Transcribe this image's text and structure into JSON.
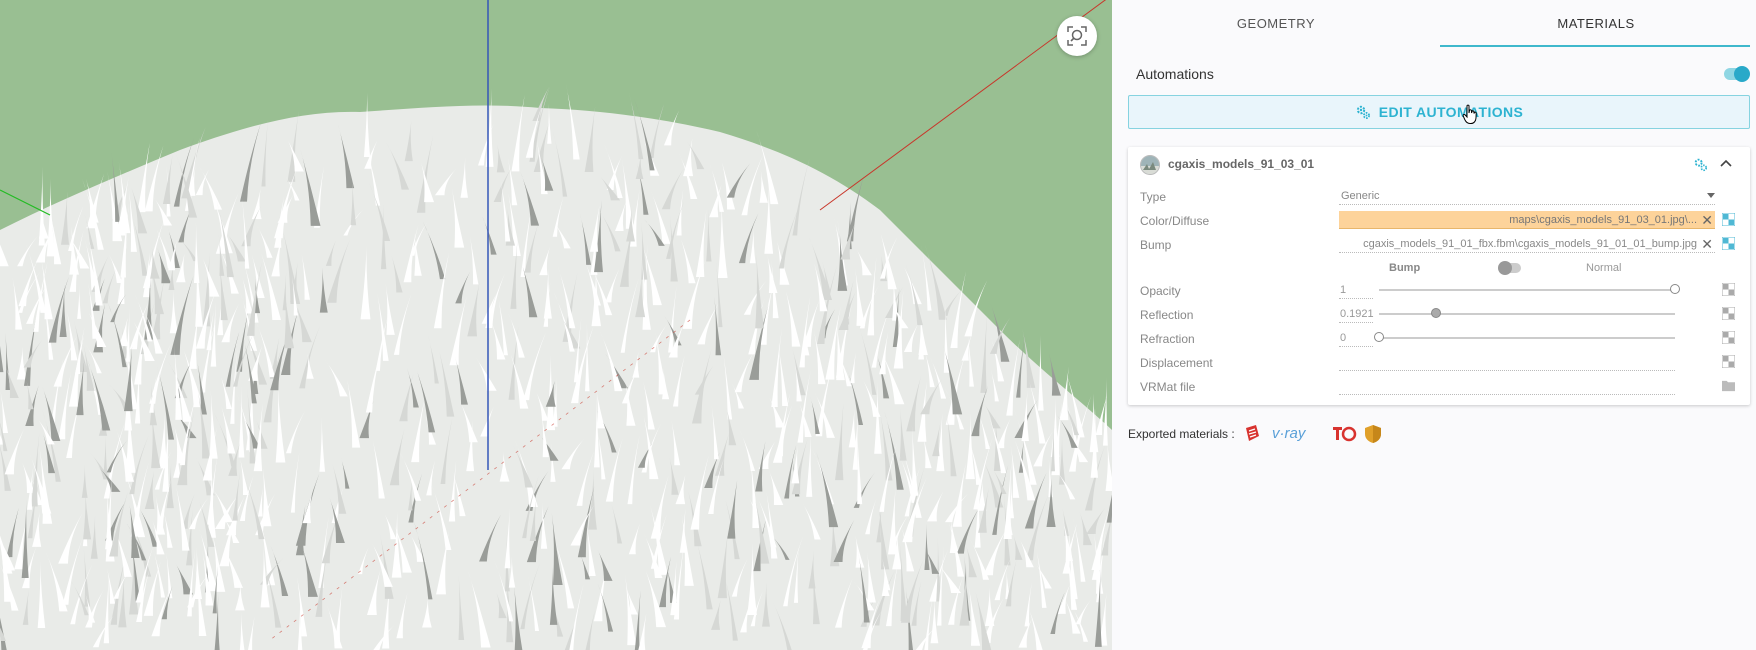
{
  "tabs": [
    {
      "label": "GEOMETRY",
      "active": false
    },
    {
      "label": "MATERIALS",
      "active": true
    }
  ],
  "automations": {
    "label": "Automations",
    "enabled": true
  },
  "edit_button": {
    "label": "EDIT AUTOMATIONS"
  },
  "material": {
    "name": "cgaxis_models_91_03_01",
    "properties": {
      "type": {
        "label": "Type",
        "value": "Generic"
      },
      "color_diffuse": {
        "label": "Color/Diffuse",
        "value": "maps\\cgaxis_models_91_03_01.jpg\\..."
      },
      "bump": {
        "label": "Bump",
        "value": "cgaxis_models_91_01_fbx.fbm\\cgaxis_models_91_01_01_bump.jpg"
      },
      "bump_toggle": {
        "left_label": "Bump",
        "right_label": "Normal"
      },
      "opacity": {
        "label": "Opacity",
        "value": "1",
        "slider": 1.0
      },
      "reflection": {
        "label": "Reflection",
        "value": "0.1921",
        "slider": 0.1921
      },
      "refraction": {
        "label": "Refraction",
        "value": "0",
        "slider": 0.0
      },
      "displacement": {
        "label": "Displacement"
      },
      "vrmat": {
        "label": "VRMat file"
      }
    }
  },
  "exported": {
    "label": "Exported materials :",
    "icons": [
      "sketchup-icon",
      "vray-icon",
      "corona-icon",
      "enscape-icon"
    ],
    "vray_text": "v·ray"
  },
  "colors": {
    "accent": "#3fb8cc",
    "viewport_bg": "#99bf92",
    "highlight": "#fdd39a"
  }
}
